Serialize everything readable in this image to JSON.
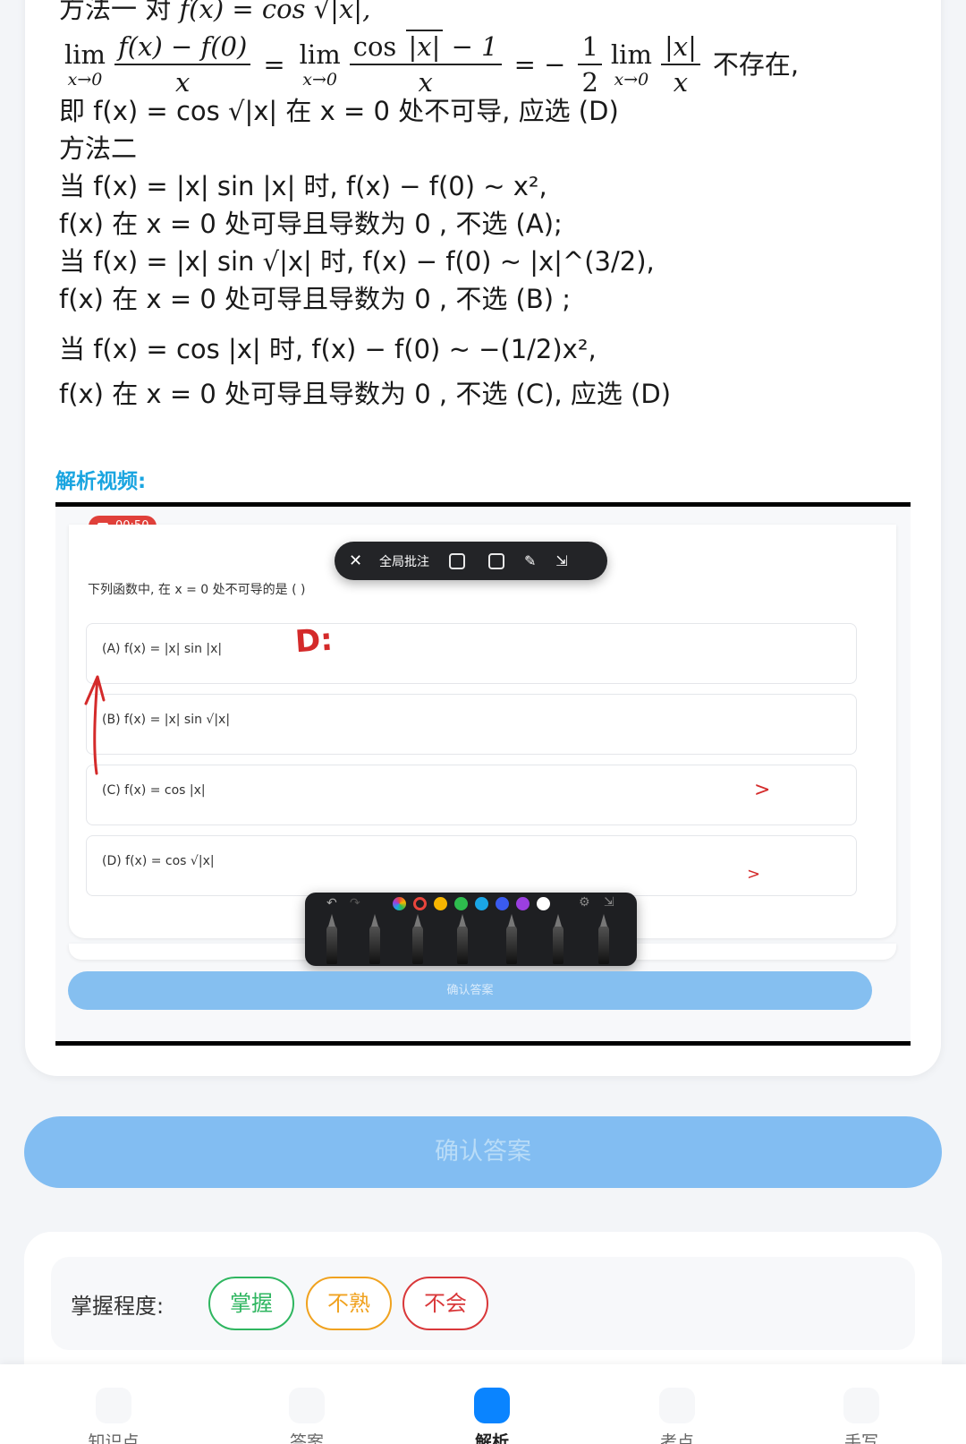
{
  "solution": {
    "method1_intro_text": "方法一 对",
    "method1_intro_math": "f(x) = cos √|x|,",
    "limit_tail_text": "不存在,",
    "conclusion_text": "即 f(x) = cos √|x| 在 x = 0 处不可导, 应选 (D)",
    "method2_title": "方法二",
    "lines": [
      "当 f(x) = |x| sin |x| 时, f(x) − f(0) ~ x²,",
      "f(x) 在 x = 0 处可导且导数为 0 , 不选 (A);",
      "当 f(x) = |x| sin √|x| 时, f(x) − f(0) ~ |x|^(3/2),",
      "f(x) 在 x = 0 处可导且导数为 0 , 不选 (B) ;",
      "当 f(x) = cos |x| 时, f(x) − f(0) ~ −(1/2)x²,",
      "f(x) 在 x = 0 处可导且导数为 0 , 不选 (C), 应选 (D)"
    ]
  },
  "video": {
    "heading": "解析视频:",
    "recording_time": "00:50",
    "toolbar_label": "全局批注",
    "question": "下列函数中, 在 x = 0 处不可导的是 (   )",
    "options": [
      "(A) f(x) = |x| sin |x|",
      "(B) f(x) = |x| sin √|x|",
      "(C) f(x) = cos |x|",
      "(D) f(x) = cos √|x|"
    ],
    "annotations": {
      "d_mark": "D:",
      "c_mark": ">",
      "d_mark2": ">"
    },
    "swatch_colors": [
      "#e8453c",
      "#f7b500",
      "#2ebd4e",
      "#1aa6e6",
      "#3a5bf0",
      "#9b3fe0",
      "#ffffff"
    ],
    "confirm_label": "确认答案"
  },
  "main_confirm_label": "确认答案",
  "mastery": {
    "label": "掌握程度:",
    "options": [
      "掌握",
      "不熟",
      "不会"
    ],
    "colors": {
      "mastered": "#2fb660",
      "unfamiliar": "#f0a21f",
      "unknown": "#d9383a"
    }
  },
  "bottom_nav": {
    "items": [
      {
        "label": "知识点",
        "icon": "knowledge-icon"
      },
      {
        "label": "答案",
        "icon": "answer-icon"
      },
      {
        "label": "解析",
        "icon": "analysis-icon",
        "active": true
      },
      {
        "label": "考点",
        "icon": "exam-point-icon"
      },
      {
        "label": "手写",
        "icon": "handwrite-icon"
      }
    ],
    "active_color": "#0a84ff"
  }
}
